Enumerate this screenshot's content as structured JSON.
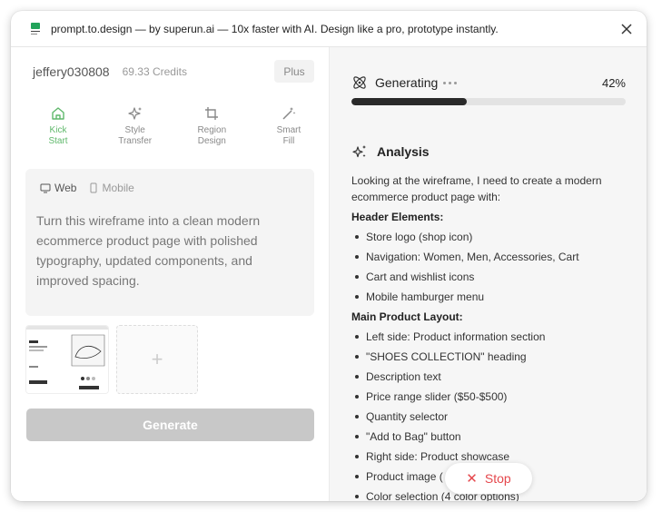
{
  "titlebar": {
    "title": "prompt.to.design — by superun.ai — 10x faster with AI. Design like a pro, prototype instantly."
  },
  "account": {
    "username": "jeffery030808",
    "credits": "69.33 Credits",
    "plan_button": "Plus"
  },
  "tools": [
    {
      "label_line1": "Kick",
      "label_line2": "Start",
      "icon": "home-icon",
      "active": true
    },
    {
      "label_line1": "Style",
      "label_line2": "Transfer",
      "icon": "sparkle-icon",
      "active": false
    },
    {
      "label_line1": "Region",
      "label_line2": "Design",
      "icon": "crop-icon",
      "active": false
    },
    {
      "label_line1": "Smart",
      "label_line2": "Fill",
      "icon": "magic-wand-icon",
      "active": false
    }
  ],
  "prompt": {
    "modes": {
      "web": "Web",
      "mobile": "Mobile"
    },
    "selected_mode": "Web",
    "text": "Turn this wireframe into a clean modern ecommerce product page with polished typography, updated components, and improved spacing."
  },
  "add_image_symbol": "+",
  "generate_label": "Generate",
  "status": {
    "label": "Generating",
    "percent_text": "42%",
    "progress": 0.42
  },
  "analysis": {
    "title": "Analysis",
    "intro": "Looking at the wireframe, I need to create a modern ecommerce product page with:",
    "header_title": "Header Elements:",
    "header_items": [
      "Store logo (shop icon)",
      "Navigation: Women, Men, Accessories, Cart",
      "Cart and wishlist icons",
      "Mobile hamburger menu"
    ],
    "main_title": "Main Product Layout:",
    "main_items": [
      "Left side: Product information section",
      "\"SHOES COLLECTION\" heading",
      "Description text",
      "Price range slider ($50-$500)",
      "Quantity selector",
      "\"Add to Bag\" button",
      "Right side: Product showcase",
      "Product image (",
      "Color selection (4 color options)"
    ]
  },
  "stop_label": "Stop",
  "colors": {
    "accent_active": "#5fb86b",
    "stop_red": "#e5484d",
    "progress_fill": "#2a2a2a"
  }
}
